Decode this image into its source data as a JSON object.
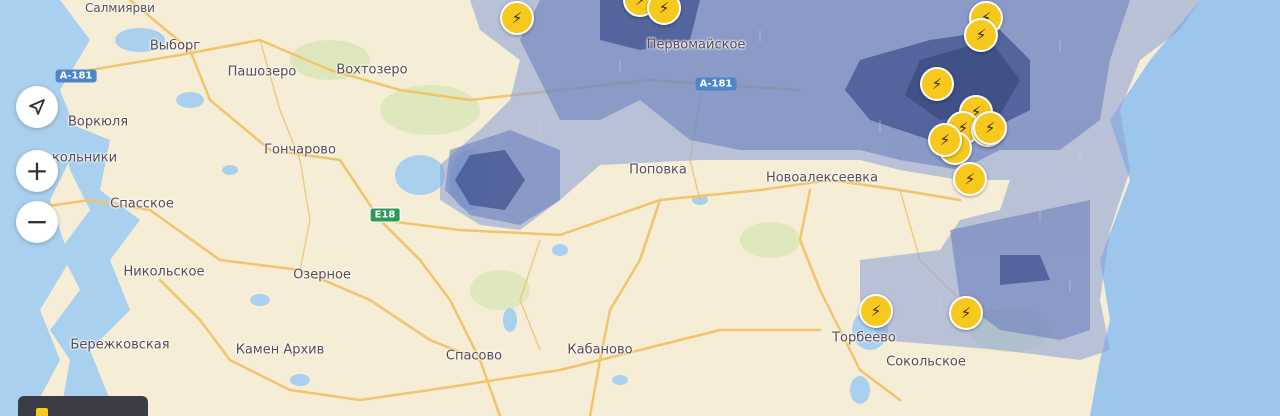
{
  "map": {
    "places": [
      {
        "id": "top-left-town",
        "name": "Салмиярви"
      },
      {
        "id": "vyborg",
        "name": "Выборг"
      },
      {
        "id": "town-1",
        "name": "Пашозеро"
      },
      {
        "id": "town-2",
        "name": "Вохтозеро"
      },
      {
        "id": "town-3",
        "name": "Воркюля"
      },
      {
        "id": "town-4",
        "name": "Гончарово"
      },
      {
        "id": "town-5",
        "name": "Сокольники"
      },
      {
        "id": "town-6",
        "name": "Спасское"
      },
      {
        "id": "town-7",
        "name": "Никольское"
      },
      {
        "id": "town-8",
        "name": "Озерное"
      },
      {
        "id": "town-9",
        "name": "Бережковская"
      },
      {
        "id": "town-10",
        "name": "Камен Архив"
      },
      {
        "id": "town-11",
        "name": "Первомайское"
      },
      {
        "id": "town-12",
        "name": "Поповка"
      },
      {
        "id": "town-13",
        "name": "Новоалексеевка"
      },
      {
        "id": "town-14",
        "name": "Спасово"
      },
      {
        "id": "town-15",
        "name": "Кабаново"
      },
      {
        "id": "town-16",
        "name": "Торбеево"
      },
      {
        "id": "town-17",
        "name": "Сокольское"
      }
    ],
    "road_badges": [
      "А-181",
      "А-181",
      "Е18"
    ],
    "lightning_icon": "lightning-bolt-icon",
    "lightning_count": 15
  },
  "controls": {
    "locate_icon": "navigation-arrow-icon",
    "zoom_in": "+",
    "zoom_out": "−"
  },
  "colors": {
    "land": "#f5edd6",
    "water": "#a9d0ef",
    "sea": "#9cc6ec",
    "forest": "#dbe6b8",
    "road": "#f2c46b",
    "precip_light": "#8fa3d6",
    "precip_heavy": "#3c4f8a",
    "lightning": "#f7c81e"
  }
}
